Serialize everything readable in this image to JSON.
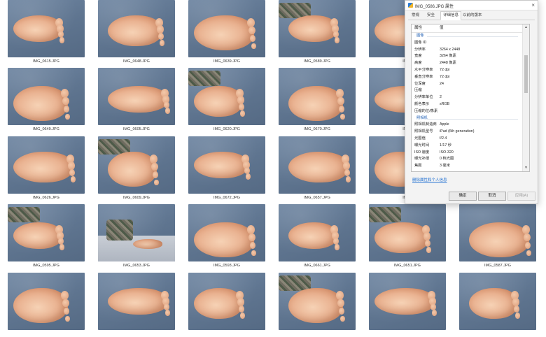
{
  "gallery": {
    "captions": [
      "IMG_0615.JPG",
      "IMG_0648.JPG",
      "IMG_0639.JPG",
      "IMG_0589.JPG",
      "IMG_",
      "IMG_0649.JPG",
      "IMG_0605.JPG",
      "IMG_0620.JPG",
      "IMG_0670.JPG",
      "IMG_",
      "IMG_0626.JPG",
      "IMG_0609.JPG",
      "IMG_0672.JPG",
      "IMG_0657.JPG",
      "IMG_",
      "IMG_0595.JPG",
      "IMG_0653.JPG",
      "IMG_0593.JPG",
      "IMG_0661.JPG",
      "IMG_0651.JPG",
      "IMG_0587.JPG"
    ]
  },
  "dialog": {
    "title": "IMG_0586.JPG 属性",
    "close_glyph": "×",
    "tabs": [
      "常规",
      "安全",
      "详细信息",
      "以前的版本"
    ],
    "active_tab": 2,
    "table_header": {
      "property": "属性",
      "value": "值"
    },
    "rows": [
      {
        "k": "图像",
        "v": "",
        "section": true
      },
      {
        "k": "图像 ID",
        "v": ""
      },
      {
        "k": "分辨率",
        "v": "3264 x 2448"
      },
      {
        "k": "宽度",
        "v": "3264 像素"
      },
      {
        "k": "高度",
        "v": "2448 像素"
      },
      {
        "k": "水平分辨率",
        "v": "72 dpi"
      },
      {
        "k": "垂直分辨率",
        "v": "72 dpi"
      },
      {
        "k": "位深度",
        "v": "24"
      },
      {
        "k": "压缩",
        "v": ""
      },
      {
        "k": "分辨率单位",
        "v": "2"
      },
      {
        "k": "颜色表示",
        "v": "sRGB"
      },
      {
        "k": "压缩的位/像素",
        "v": ""
      },
      {
        "k": "照相机",
        "v": "",
        "section": true
      },
      {
        "k": "照相机制造商",
        "v": "Apple"
      },
      {
        "k": "照相机型号",
        "v": "iPad (6th generation)"
      },
      {
        "k": "光圈值",
        "v": "f/2.4"
      },
      {
        "k": "曝光时间",
        "v": "1/17 秒"
      },
      {
        "k": "ISO 速度",
        "v": "ISO-320"
      },
      {
        "k": "曝光补偿",
        "v": "0 档光圈"
      },
      {
        "k": "焦距",
        "v": "3 毫米"
      }
    ],
    "scroll_up": "▲",
    "scroll_down": "▼",
    "remove_link": "删除属性和个人信息",
    "buttons": {
      "ok": "确定",
      "cancel": "取消",
      "apply": "应用(A)"
    }
  },
  "colors": {
    "accent": "#1f6fd1",
    "section_text": "#1f5fb4"
  }
}
